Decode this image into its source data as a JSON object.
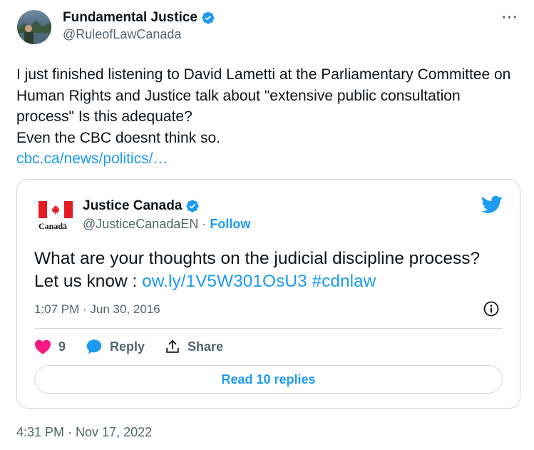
{
  "author": {
    "name": "Fundamental Justice",
    "handle": "@RuleofLawCanada"
  },
  "more_label": "···",
  "tweet": {
    "text": "I just finished listening to David Lametti at the Parliamentary Committee on Human Rights and Justice talk about \"extensive public consultation process\" Is this adequate?\nEven the CBC doesnt think so.",
    "link": "cbc.ca/news/politics/…",
    "timestamp": "4:31 PM · Nov 17, 2022"
  },
  "quote": {
    "logo_wordmark": "Canadä",
    "name": "Justice Canada",
    "handle": "@JusticeCanadaEN",
    "separator": " · ",
    "follow_label": "Follow",
    "text_line1": "What are your thoughts on the judicial discipline process?",
    "text_prefix": "Let us know : ",
    "text_link": "ow.ly/1V5W301OsU3",
    "text_hashtag": "#cdnlaw",
    "time": "1:07 PM · Jun 30, 2016",
    "likes_count": "9",
    "reply_label": "Reply",
    "share_label": "Share",
    "read_replies_label": "Read 10 replies"
  },
  "colors": {
    "accent": "#1d9bf0",
    "like": "#f91880",
    "muted": "#536471",
    "flag_red": "#e31b23"
  },
  "icons": [
    "verified-badge-icon",
    "more-icon",
    "maple-leaf-icon",
    "twitter-bird-icon",
    "info-icon",
    "heart-icon",
    "reply-bubble-icon",
    "share-icon"
  ]
}
